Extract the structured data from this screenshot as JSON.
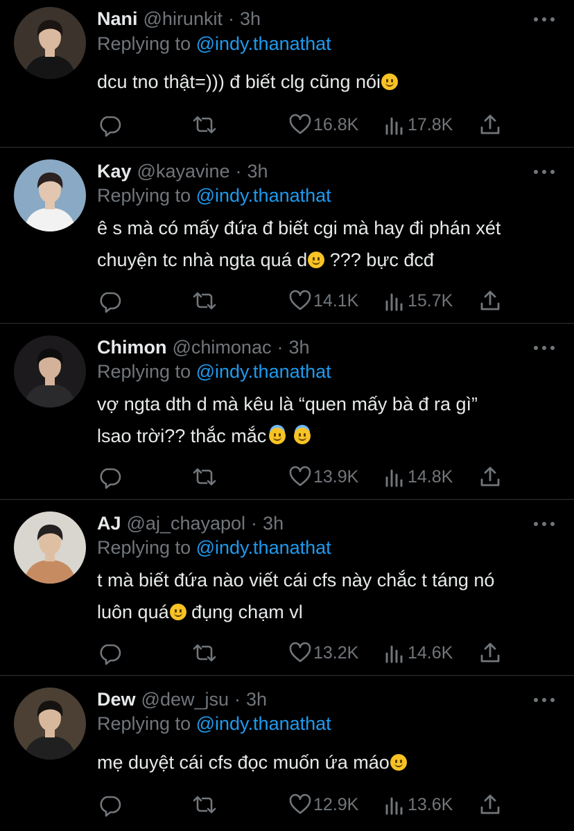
{
  "reply_prefix": "Replying to",
  "tweets": [
    {
      "name": "Nani",
      "handle": "@hirunkit",
      "dot": "·",
      "time": "3h",
      "reply_to": "@indy.thanathat",
      "lines": [
        "dcu tno thật=))) đ biết clg cũng nói"
      ],
      "likes": "16.8K",
      "views": "17.8K",
      "avatar": {
        "bg": "#3b332c",
        "skin": "#d9b9a0",
        "hair": "#1a1412",
        "shirt": "#151515"
      }
    },
    {
      "name": "Kay",
      "handle": "@kayavine",
      "dot": "·",
      "time": "3h",
      "reply_to": "@indy.thanathat",
      "lines": [
        "ê s mà có mấy đứa đ biết cgi mà hay đi phán xét",
        "chuyện tc nhà ngta quá d",
        " ??? bực đcđ"
      ],
      "likes": "14.1K",
      "views": "15.7K",
      "avatar": {
        "bg": "#8aa9c4",
        "skin": "#e2c6b0",
        "hair": "#2b2120",
        "shirt": "#f2f2f2"
      }
    },
    {
      "name": "Chimon",
      "handle": "@chimonac",
      "dot": "·",
      "time": "3h",
      "reply_to": "@indy.thanathat",
      "lines": [
        "vợ ngta dth d mà kêu là “quen mấy bà đ ra gì”",
        "lsao trời?? thắc mắc"
      ],
      "likes": "13.9K",
      "views": "14.8K",
      "avatar": {
        "bg": "#1c1a1c",
        "skin": "#d4b29a",
        "hair": "#0e0d0e",
        "shirt": "#2a2a2c"
      }
    },
    {
      "name": "AJ",
      "handle": "@aj_chayapol",
      "dot": "·",
      "time": "3h",
      "reply_to": "@indy.thanathat",
      "lines": [
        "t mà biết đứa nào viết cái cfs này chắc t táng nó",
        "luôn quá",
        " đụng chạm vl"
      ],
      "likes": "13.2K",
      "views": "14.6K",
      "avatar": {
        "bg": "#d9d6d0",
        "skin": "#dfbfa2",
        "hair": "#23201f",
        "shirt": "#c78b62"
      }
    },
    {
      "name": "Dew",
      "handle": "@dew_jsu",
      "dot": "·",
      "time": "3h",
      "reply_to": "@indy.thanathat",
      "lines": [
        "mẹ duyệt cái cfs đọc muốn ứa máo"
      ],
      "likes": "12.9K",
      "views": "13.6K",
      "avatar": {
        "bg": "#4b4033",
        "skin": "#d8b89d",
        "hair": "#151210",
        "shirt": "#202020"
      }
    }
  ],
  "icons": {
    "reply": "reply-icon",
    "retweet": "retweet-icon",
    "like": "heart-icon",
    "views": "views-icon",
    "share": "share-icon",
    "more": "more-icon"
  },
  "colors": {
    "background": "#000000",
    "text": "#e7e9ea",
    "muted": "#71767b",
    "link": "#1d9bf0",
    "divider": "#2f3336"
  }
}
